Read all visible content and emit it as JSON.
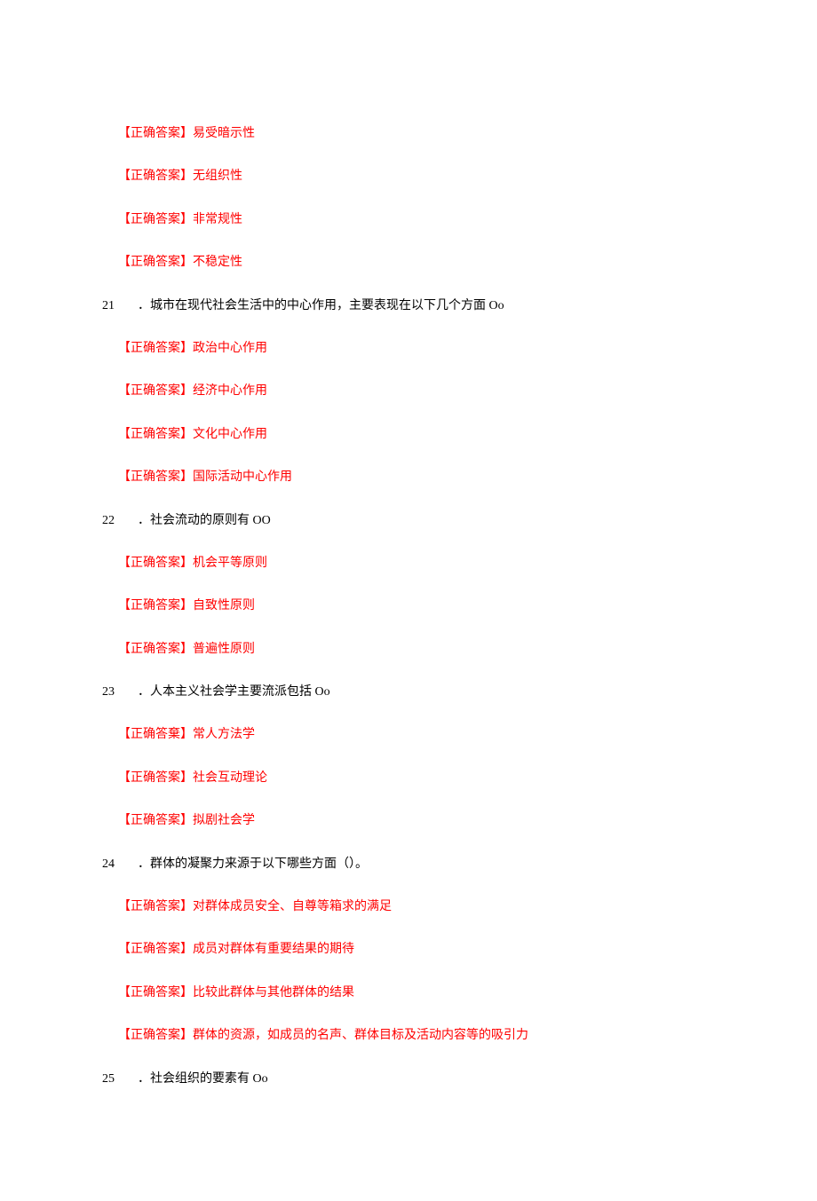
{
  "answer_label": "【正确答案】",
  "answer_label_alt": "【正确答棄】",
  "blocks": [
    {
      "type": "answers",
      "items": [
        "易受暗示性",
        "无组织性",
        "非常规性",
        "不稳定性"
      ]
    },
    {
      "type": "question",
      "num": "21",
      "text": "．城市在现代社会生活中的中心作用，主要表现在以下几个方面 Oo"
    },
    {
      "type": "answers",
      "items": [
        "政治中心作用",
        "经济中心作用",
        "文化中心作用",
        "国际活动中心作用"
      ]
    },
    {
      "type": "question",
      "num": "22",
      "text": "．社会流动的原则有 OO"
    },
    {
      "type": "answers",
      "items": [
        "机会平等原则",
        "自致性原则",
        "普遍性原则"
      ]
    },
    {
      "type": "question",
      "num": "23",
      "text": "．人本主义社会学主要流派包括 Oo"
    },
    {
      "type": "answers_alt",
      "items": [
        "常人方法学"
      ]
    },
    {
      "type": "answers",
      "items": [
        "社会互动理论",
        "拟剧社会学"
      ]
    },
    {
      "type": "question",
      "num": "24",
      "text": "．群体的凝聚力来源于以下哪些方面（）。"
    },
    {
      "type": "answers",
      "items": [
        "对群体成员安全、自尊等箱求的满足",
        "成员对群体有重要结果的期待",
        "比较此群体与其他群体的结果",
        "群体的资源，如成员的名声、群体目标及活动内容等的吸引力"
      ]
    },
    {
      "type": "question",
      "num": "25",
      "text": "．社会组织的要素有 Oo"
    }
  ]
}
